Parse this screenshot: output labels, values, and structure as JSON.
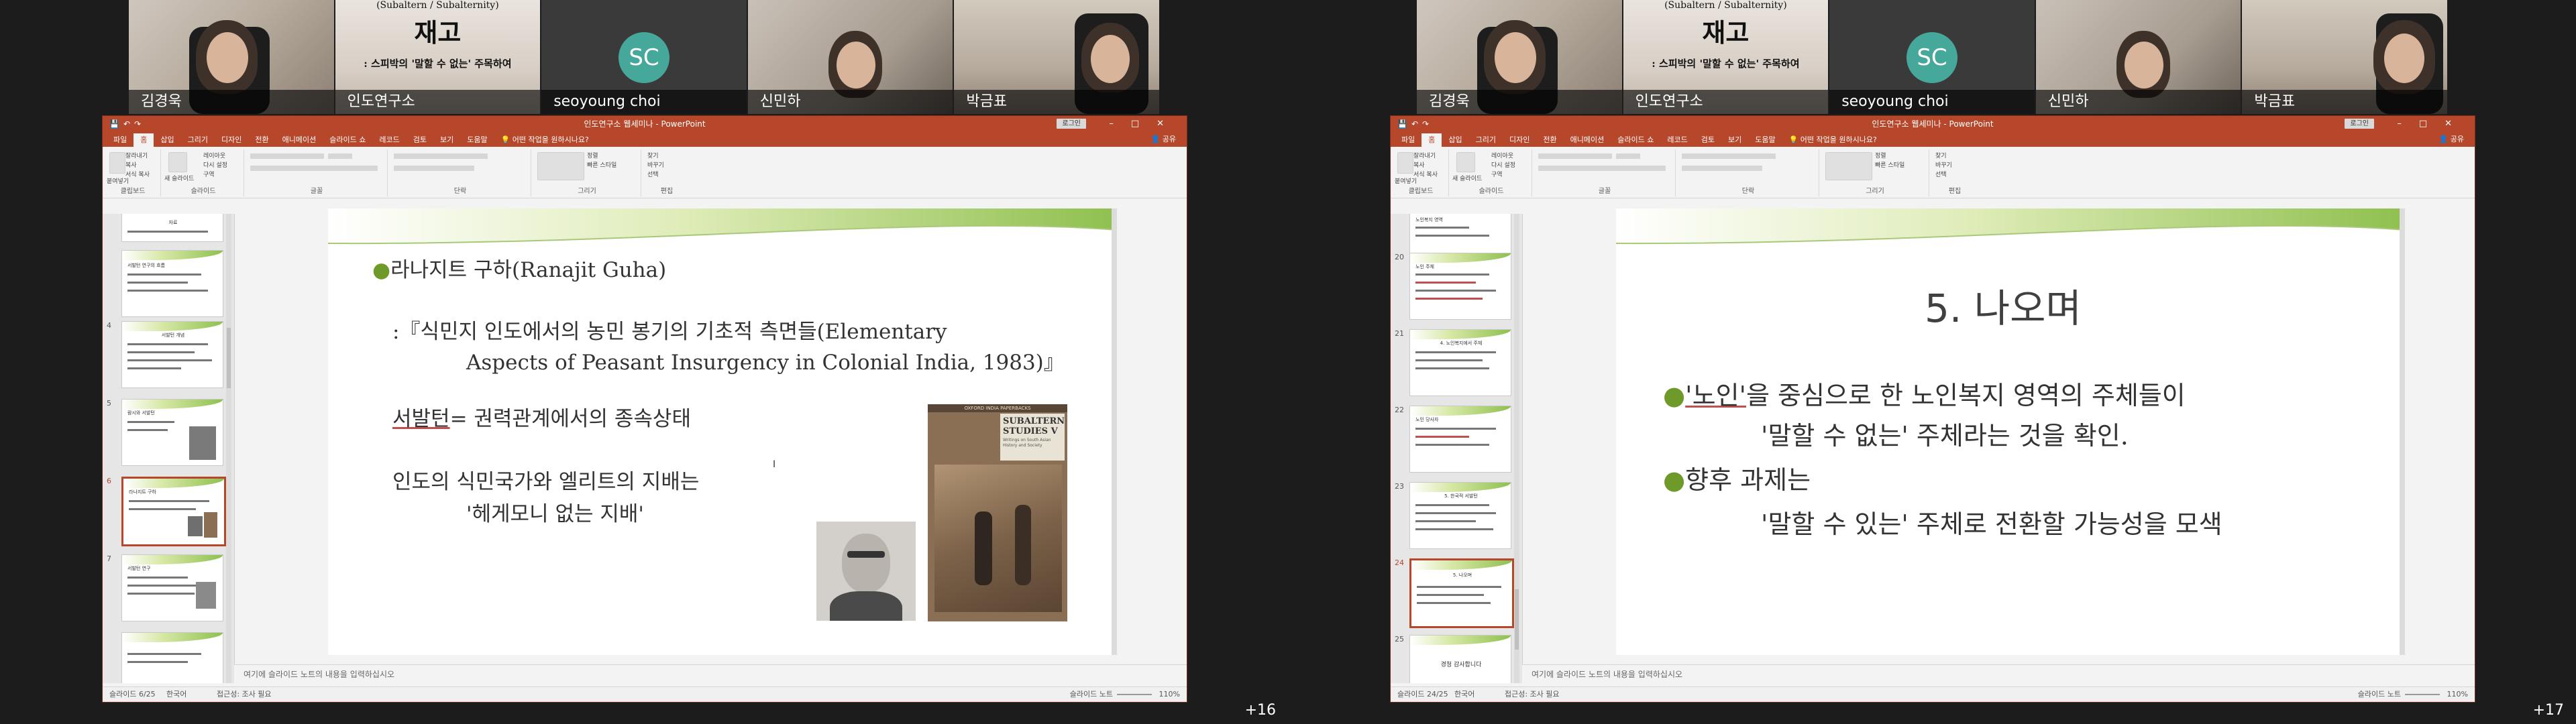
{
  "participants_left": [
    {
      "name": "김경욱"
    },
    {
      "name": "인도연구소",
      "poster_top": "(Subaltern / Subalternity)",
      "poster_title": "재고",
      "poster_sub": ": 스피박의 '말할 수 없는' 주목하여"
    },
    {
      "name": "seoyoung choi",
      "initials": "SC"
    },
    {
      "name": "신민하"
    },
    {
      "name": "박금표"
    }
  ],
  "participants_right": [
    {
      "name": "김경욱"
    },
    {
      "name": "인도연구소",
      "poster_top": "(Subaltern / Subalternity)",
      "poster_title": "재고",
      "poster_sub": ": 스피박의 '말할 수 없는' 주목하여"
    },
    {
      "name": "seoyoung choi",
      "initials": "SC"
    },
    {
      "name": "신민하"
    },
    {
      "name": "박금표"
    }
  ],
  "ppt": {
    "window_title": "인도연구소 웹세미나 - PowerPoint",
    "login": "로그인",
    "tabs": [
      "파일",
      "홈",
      "삽입",
      "그리기",
      "디자인",
      "전환",
      "애니메이션",
      "슬라이드 쇼",
      "레코드",
      "검토",
      "보기",
      "도움말"
    ],
    "tell_me": "어떤 작업을 원하시나요?",
    "share": "공유",
    "ribbon_groups": [
      "클립보드",
      "슬라이드",
      "글꼴",
      "단락",
      "그리기",
      "편집"
    ],
    "ribbon_buttons": {
      "paste": "붙여넣기",
      "cut": "잘라내기",
      "copy": "복사",
      "format": "서식 복사",
      "new_slide": "새 슬라이드",
      "layout": "레이아웃",
      "reset": "다시 설정",
      "section": "구역",
      "find": "찾기",
      "replace": "바꾸기",
      "select": "선택",
      "arrange": "정렬",
      "quick_styles": "빠른 스타일"
    },
    "notes_placeholder": "여기에 슬라이드 노트의 내용을 입력하십시오",
    "language": "한국어",
    "accessibility": "접근성: 조사 필요",
    "notes_btn": "슬라이드 노트",
    "zoom": "110%"
  },
  "left_status": {
    "slide": "슬라이드 6/25"
  },
  "right_status": {
    "slide": "슬라이드 24/25"
  },
  "left_slide": {
    "line1": "라나지트 구하(Ranajit Guha)",
    "line2": ":『식민지 인도에서의 농민 봉기의 기초적 측면들(Elementary",
    "line3": "Aspects of Peasant Insurgency in Colonial India, 1983)』",
    "line4_a": "서발턴",
    "line4_b": "= 권력관계에서의 종속상태",
    "line5": "인도의 식민국가와 엘리트의 지배는",
    "line6": "'헤게모니 없는 지배'",
    "book_title": "SUBALTERN STUDIES V",
    "book_sub": "Writings on South Asian History and Society",
    "book_series": "OXFORD INDIA PAPERBACKS"
  },
  "right_slide": {
    "title": "5. 나오며",
    "b1_a": "'노인'",
    "b1_b": "을 중심으로 한 노인복지 영역의 주체들이",
    "b1_c": "'말할 수 없는' 주체라는 것을 확인.",
    "b2_a": "향후 과제는",
    "b2_b": "'말할 수 있는' 주체로 전환할 가능성을 모색"
  },
  "left_thumbs": [
    {
      "num": "",
      "lines": [
        "자료"
      ]
    },
    {
      "num": "",
      "lines": [
        "서발턴 연구의 흐름"
      ]
    },
    {
      "num": "4",
      "lines": [
        "서발턴 개념"
      ]
    },
    {
      "num": "5",
      "lines": [
        "람시와 서발턴"
      ]
    },
    {
      "num": "6",
      "lines": [
        "라나지트 구하"
      ]
    },
    {
      "num": "7",
      "lines": [
        "서발턴 연구"
      ]
    },
    {
      "num": "8",
      "lines": [
        ""
      ]
    }
  ],
  "right_thumbs": [
    {
      "num": "",
      "lines": [
        "노인복지 영역"
      ]
    },
    {
      "num": "20",
      "lines": [
        "노인 주체"
      ]
    },
    {
      "num": "21",
      "lines": [
        "4. 노인복지에서 주체"
      ]
    },
    {
      "num": "22",
      "lines": [
        "노인 당사자"
      ]
    },
    {
      "num": "23",
      "lines": [
        "5. 한국적 서발턴"
      ]
    },
    {
      "num": "24",
      "lines": [
        "5. 나오며"
      ]
    },
    {
      "num": "25",
      "lines": [
        "경청 감사합니다"
      ]
    }
  ],
  "overflow_left": "+16",
  "overflow_right": "+17",
  "colors": {
    "ppt_accent": "#b7472a",
    "slide_green": "#8fc04f",
    "avatar": "#45a89b"
  }
}
